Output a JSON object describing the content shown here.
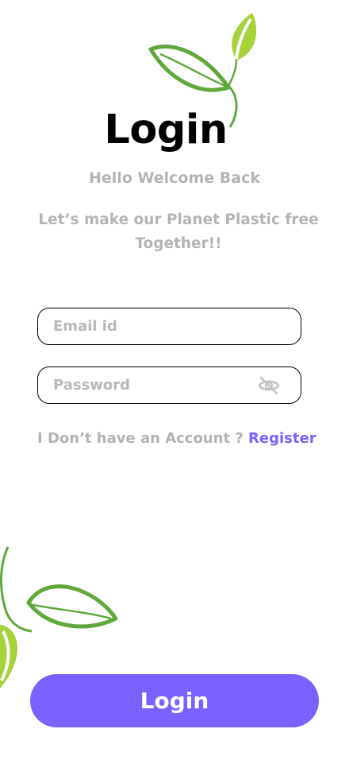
{
  "header": {
    "title": "Login",
    "subtitle": "Hello Welcome Back",
    "tagline": "Let’s make our Planet Plastic free Together!!"
  },
  "form": {
    "email_placeholder": "Email id",
    "password_placeholder": "Password",
    "eye_icon": "eye-slash-icon"
  },
  "register": {
    "prompt": "I Don’t have an Account ? ",
    "link": "Register"
  },
  "login_button": "Login",
  "colors": {
    "accent": "#7b61ff",
    "muted_text": "#b3b3b3",
    "leaf_dark": "#5fa83a",
    "leaf_light": "#a6d23a"
  }
}
